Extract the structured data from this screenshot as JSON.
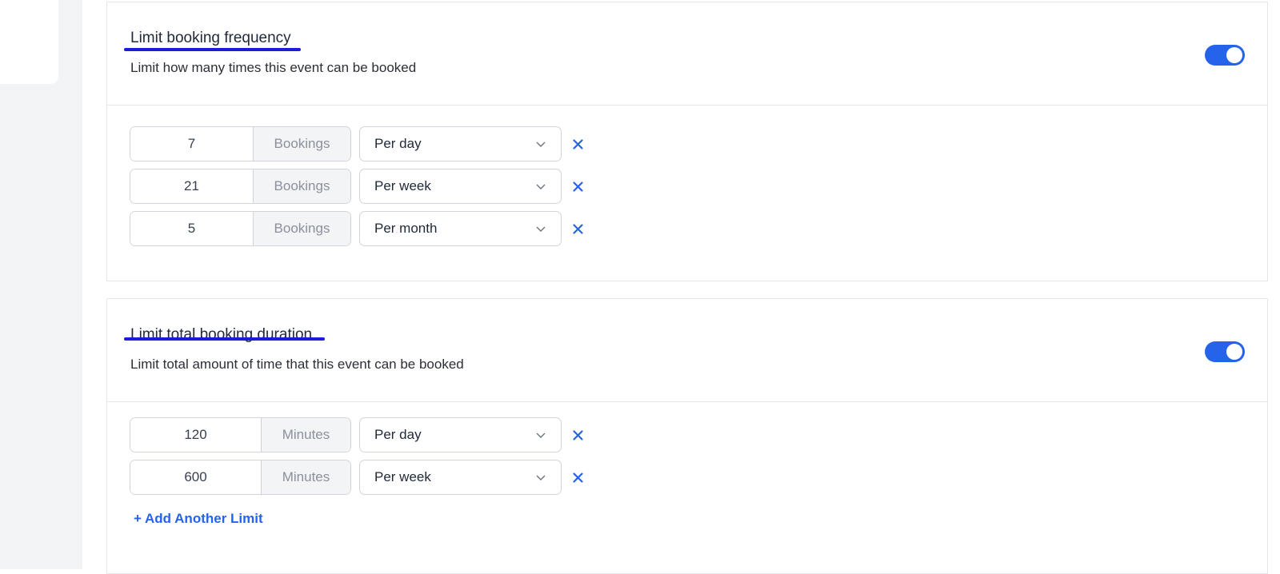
{
  "frequency": {
    "title": "Limit booking frequency",
    "description": "Limit how many times this event can be booked",
    "toggle_on": true,
    "rows": [
      {
        "value": "7",
        "unit": "Bookings",
        "period": "Per day"
      },
      {
        "value": "21",
        "unit": "Bookings",
        "period": "Per week"
      },
      {
        "value": "5",
        "unit": "Bookings",
        "period": "Per month"
      }
    ]
  },
  "duration": {
    "title": "Limit total booking duration",
    "description": "Limit total amount of time that this event can be booked",
    "toggle_on": true,
    "rows": [
      {
        "value": "120",
        "unit": "Minutes",
        "period": "Per day"
      },
      {
        "value": "600",
        "unit": "Minutes",
        "period": "Per week"
      }
    ],
    "add_label": "+ Add Another Limit"
  },
  "colors": {
    "accent": "#2563eb",
    "annotation_underline": "#1d1bdb"
  },
  "icons": {
    "toggle": "toggle-on-icon",
    "dropdown": "chevron-down-icon",
    "remove": "close-icon"
  }
}
